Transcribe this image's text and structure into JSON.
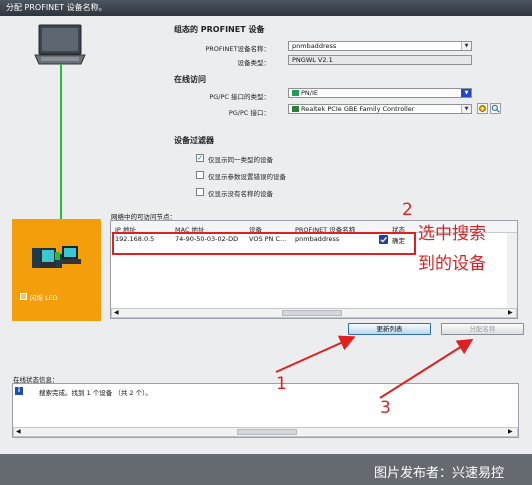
{
  "window": {
    "title": "分配 PROFINET 设备名称。"
  },
  "configured": {
    "heading": "组态的 PROFINET 设备",
    "name_label": "PROFINET设备名称：",
    "name_value": "pnmbaddress",
    "type_label": "设备类型：",
    "type_value": "PNGWL V2.1"
  },
  "online": {
    "heading": "在线访问",
    "iface_type_label": "PG/PC 接口的类型：",
    "iface_type_value": "PN/IE",
    "iface_label": "PG/PC 接口：",
    "iface_value": "Realtek PCIe GBE Family Controller"
  },
  "filter": {
    "heading": "设备过滤器",
    "options": [
      {
        "label": "仅显示同一类型的设备",
        "checked": true
      },
      {
        "label": "仅显示参数设置错误的设备",
        "checked": false
      },
      {
        "label": "仅显示没有名称的设备",
        "checked": false
      }
    ]
  },
  "nodes": {
    "caption": "网络中的可访问节点：",
    "columns": [
      "IP 地址",
      "MAC 地址",
      "设备",
      "PROFINET 设备名称",
      "状态"
    ],
    "rows": [
      {
        "ip": "192.168.0.5",
        "mac": "74-90-50-03-02-DD",
        "device": "VOS PN C...",
        "name": "pnmbaddress",
        "status": "确定"
      }
    ]
  },
  "buttons": {
    "refresh": "更新列表",
    "assign": "分配名称"
  },
  "left_panel": {
    "flash_label": "闪烁 LED"
  },
  "status": {
    "caption": "在线状态信息：",
    "message": "搜索完成。找到 1 个设备 （共 2 个）。"
  },
  "annotations": {
    "label_1": "1",
    "label_2": "2",
    "label_3": "3",
    "note_line1": "选中搜索",
    "note_line2": "到的设备"
  },
  "watermark": "图片发布者：兴速易控",
  "colors": {
    "accent_orange": "#f59e0b",
    "annotation_red": "#e02020",
    "link_green": "#22c03a",
    "dropdown_blue": "#2447c6"
  }
}
